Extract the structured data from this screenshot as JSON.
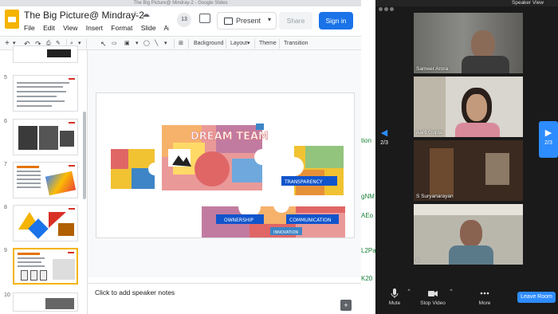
{
  "browser": {
    "title": "The Big Picture@ Mindray-2 - Google Slides"
  },
  "doc": {
    "title": "The Big Picture@ Mindray-2"
  },
  "menu": [
    "File",
    "Edit",
    "View",
    "Insert",
    "Format",
    "Slide",
    "Arrange"
  ],
  "header": {
    "comment_count": "13",
    "present_label": "Present",
    "share_label": "Share",
    "signin_label": "Sign in"
  },
  "toolbar": {
    "background": "Background",
    "layout": "Layout",
    "theme": "Theme",
    "transition": "Transition"
  },
  "filmstrip": [
    {
      "num": "5"
    },
    {
      "num": "6"
    },
    {
      "num": "7"
    },
    {
      "num": "8"
    },
    {
      "num": "9"
    },
    {
      "num": "10"
    }
  ],
  "slide_text": {
    "dream_team": "DREAM TEAM",
    "transparency": "TRANSPARENCY",
    "ownership": "OWNERSHIP",
    "communication": "COMMUNICATION",
    "innovation": "INNOVATION"
  },
  "notes": {
    "placeholder": "Click to add speaker notes"
  },
  "peek_links": [
    "tion",
    "gNM",
    "AEo",
    "L2Pa",
    "K20"
  ],
  "zoom": {
    "speaker_view": "Speaker View",
    "participants": [
      {
        "name": "Sameer Arora"
      },
      {
        "name": "Aarti Gupta"
      },
      {
        "name": "S Suryanarayan"
      },
      {
        "name": "s"
      }
    ],
    "page_left": "2/3",
    "page_right": "2/3",
    "controls": {
      "mute": "Mute",
      "video": "Stop Video",
      "more": "More",
      "leave": "Leave Room"
    }
  },
  "colors": {
    "signin": "#1a73e8",
    "zoom_blue": "#2d8cff",
    "selected_thumb": "#f4b400"
  }
}
